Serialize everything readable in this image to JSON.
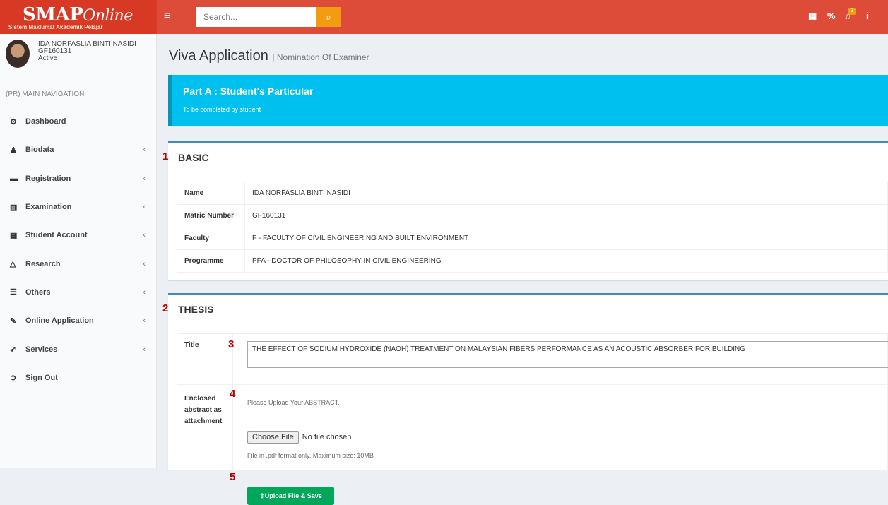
{
  "brand": {
    "logo_main": "SMAP",
    "logo_script": "Online",
    "logo_sub": "Sistem Maklumat Akademik Pelajar"
  },
  "header": {
    "menu_icon": "hamburger-icon",
    "search_placeholder": "Search...",
    "search_icon": "search-icon",
    "notification_count": "3"
  },
  "user": {
    "name": "IDA NORFASLIA BINTI NASIDI",
    "matric": "GF160131",
    "status": "Active"
  },
  "nav": {
    "header": "(PR) MAIN NAVIGATION",
    "items": [
      {
        "label": "Dashboard",
        "icon": "dashboard-icon",
        "glyph": "⚙",
        "chevron": ""
      },
      {
        "label": "Biodata",
        "icon": "person-icon",
        "glyph": "♟",
        "chevron": "‹"
      },
      {
        "label": "Registration",
        "icon": "briefcase-icon",
        "glyph": "▬",
        "chevron": "‹"
      },
      {
        "label": "Examination",
        "icon": "chart-icon",
        "glyph": "▥",
        "chevron": "‹"
      },
      {
        "label": "Student Account",
        "icon": "bank-icon",
        "glyph": "▦",
        "chevron": "‹"
      },
      {
        "label": "Research",
        "icon": "flask-icon",
        "glyph": "△",
        "chevron": "‹"
      },
      {
        "label": "Others",
        "icon": "signpost-icon",
        "glyph": "☰",
        "chevron": "‹"
      },
      {
        "label": "Online Application",
        "icon": "pencil-icon",
        "glyph": "✎",
        "chevron": "‹"
      },
      {
        "label": "Services",
        "icon": "rocket-icon",
        "glyph": "➶",
        "chevron": "‹"
      },
      {
        "label": "Sign Out",
        "icon": "sign-out-icon",
        "glyph": "➲",
        "chevron": ""
      }
    ]
  },
  "page": {
    "title": "Viva Application",
    "subtitle": "| Nomination Of Examiner"
  },
  "callout": {
    "title": "Part A : Student's Particular",
    "subtitle": "To be completed by student"
  },
  "basic": {
    "marker": "1",
    "title": "BASIC",
    "rows": [
      {
        "key": "Name",
        "value": "IDA NORFASLIA BINTI NASIDI"
      },
      {
        "key": "Matric Number",
        "value": "GF160131"
      },
      {
        "key": "Faculty",
        "value": "F - FACULTY OF CIVIL ENGINEERING AND BUILT ENVIRONMENT"
      },
      {
        "key": "Programme",
        "value": "PFA - DOCTOR OF PHILOSOPHY IN CIVIL ENGINEERING"
      }
    ]
  },
  "thesis": {
    "marker": "2",
    "title": "THESIS",
    "title_label": "Title",
    "title_marker": "3",
    "title_value": "THE EFFECT OF SODIUM HYDROXIDE (NAOH) TREATMENT ON MALAYSIAN FIBERS PERFORMANCE AS AN ACOUSTIC ABSORBER FOR BUILDING",
    "abstract_label_1": "Enclosed",
    "abstract_label_2": "abstract as",
    "abstract_label_3": "attachment",
    "abstract_marker": "4",
    "upload_prompt": "Please Upload Your ABSTRACT.",
    "choose_file": "Choose File",
    "no_file": "No file chosen",
    "file_hint": "File in .pdf format only. Maximum size: 10MB",
    "upload_marker": "5",
    "upload_button": "Upload File & Save"
  }
}
